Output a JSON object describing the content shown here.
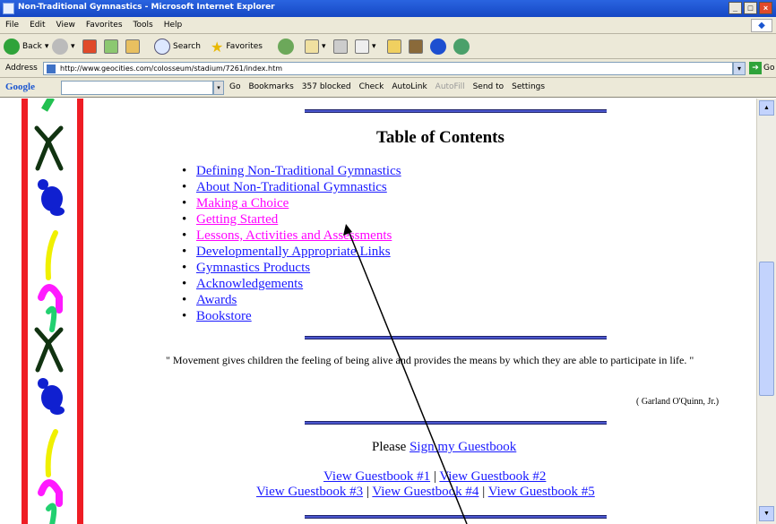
{
  "window": {
    "title": "Non-Traditional Gymnastics - Microsoft Internet Explorer",
    "buttons": [
      "_",
      "□",
      "×"
    ]
  },
  "menu": [
    "File",
    "Edit",
    "View",
    "Favorites",
    "Tools",
    "Help"
  ],
  "toolbar": {
    "back": "Back",
    "search": "Search",
    "favorites": "Favorites"
  },
  "address": {
    "label": "Address",
    "url": "http://www.geocities.com/colosseum/stadium/7261/index.htm",
    "go": "Go"
  },
  "googlebar": {
    "logo": "Google",
    "items": [
      "Go",
      "Bookmarks",
      "357 blocked",
      "Check",
      "AutoLink",
      "AutoFill",
      "Send to",
      "Settings"
    ]
  },
  "content": {
    "toc_title": "Table of Contents",
    "toc_items": [
      {
        "label": "Defining Non-Traditional Gymnastics",
        "visited": false
      },
      {
        "label": "About Non-Traditional Gymnastics",
        "visited": false
      },
      {
        "label": "Making a Choice",
        "visited": true
      },
      {
        "label": "Getting Started",
        "visited": true
      },
      {
        "label": "Lessons, Activities and Assessments",
        "visited": true
      },
      {
        "label": "Developmentally Appropriate Links",
        "visited": false
      },
      {
        "label": "Gymnastics Products",
        "visited": false
      },
      {
        "label": "Acknowledgements",
        "visited": false
      },
      {
        "label": "Awards",
        "visited": false
      },
      {
        "label": "Bookstore",
        "visited": false
      }
    ],
    "quote": "\" Movement gives children the feeling of being alive and provides the means by which they are able to participate in life. \"",
    "attribution": "( Garland O'Quinn, Jr.)",
    "guestbook_prefix": "Please",
    "guestbook_link": "Sign my Guestbook",
    "view_links": [
      "View Guestbook #1",
      "View Guestbook #2",
      "View Guestbook #3",
      "View Guestbook #4",
      "View Guestbook #5"
    ],
    "separator": "|"
  },
  "colors": {
    "link": "#1a1aff",
    "visited": "#ff00ff",
    "stripe": "#ee1d24"
  }
}
